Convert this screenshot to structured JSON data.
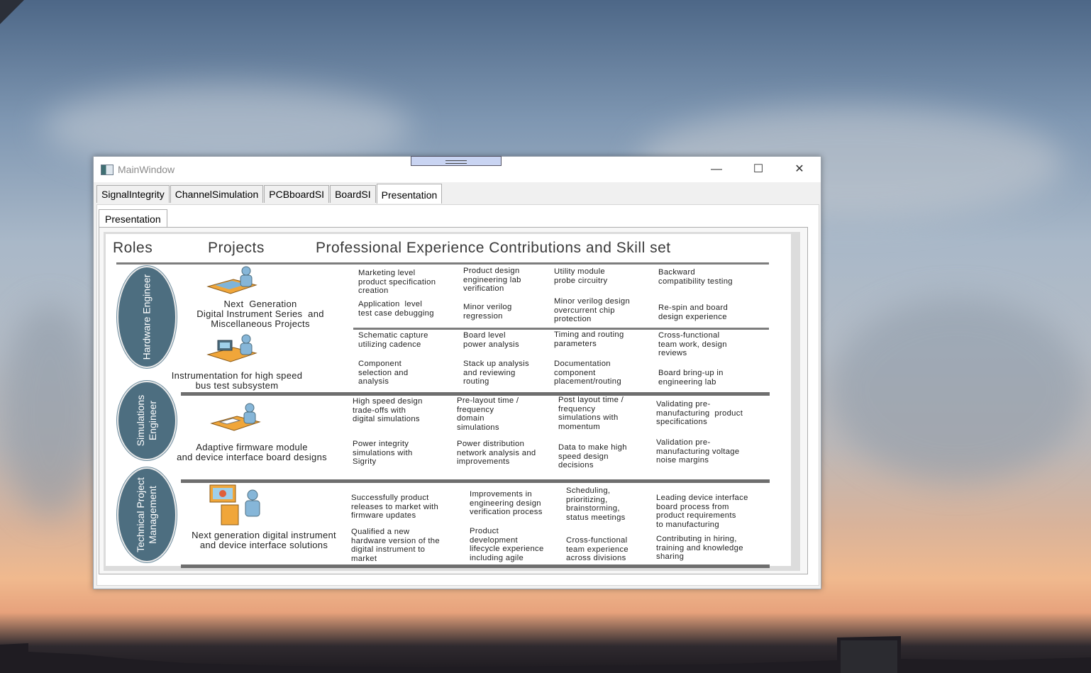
{
  "window": {
    "title": "MainWindow",
    "minimize_glyph": "—",
    "maximize_glyph": "☐",
    "close_glyph": "✕"
  },
  "tabs": [
    {
      "label": "SignalIntegrity",
      "active": false
    },
    {
      "label": "ChannelSimulation",
      "active": false
    },
    {
      "label": "PCBboardSI",
      "active": false
    },
    {
      "label": "BoardSI",
      "active": false
    },
    {
      "label": "Presentation",
      "active": true
    }
  ],
  "subtab": {
    "label": "Presentation"
  },
  "slide": {
    "headers": {
      "roles": "Roles",
      "projects": "Projects",
      "contributions": "Professional Experience Contributions and Skill set"
    },
    "roles": [
      {
        "label": "Hardware Engineer"
      },
      {
        "label": "Simulations\nEngineer"
      },
      {
        "label": "Technical Project\nManagement"
      }
    ],
    "projects": [
      {
        "label": "Next  Generation\nDigital Instrument Series  and\nMiscellaneous Projects"
      },
      {
        "label": "Instrumentation for high speed\nbus test subsystem"
      },
      {
        "label": "Adaptive firmware module\nand device interface board designs"
      },
      {
        "label": "Next generation digital instrument\nand device interface solutions"
      }
    ],
    "cells": [
      "Marketing level\nproduct specification\ncreation",
      "Product design\nengineering lab\nverification",
      "Utility module\nprobe circuitry",
      "Backward\ncompatibility testing",
      "Application  level\ntest case debugging",
      "Minor verilog\nregression",
      "Minor verilog design\novercurrent chip\nprotection",
      "Re-spin and board\ndesign experience",
      "Schematic capture\nutilizing cadence",
      "Board level\npower analysis",
      "Timing and routing\nparameters",
      "Cross-functional\nteam work, design\nreviews",
      "Component\nselection and\nanalysis",
      "Stack up analysis\nand reviewing\nrouting",
      "Documentation\ncomponent\nplacement/routing",
      "Board bring-up in\nengineering lab",
      "High speed design\ntrade-offs with\ndigital simulations",
      "Pre-layout time /\nfrequency\ndomain\nsimulations",
      "Post layout time /\nfrequency\nsimulations with\nmomentum",
      "Validating pre-\nmanufacturing  product\nspecifications",
      "Power integrity\nsimulations with\nSigrity",
      "Power distribution\nnetwork analysis and\nimprovements",
      "Data to make high\nspeed design\ndecisions",
      "Validation pre-\nmanufacturing voltage\nnoise margins",
      "Successfully product\nreleases to market with\nfirmware updates",
      "Improvements in\nengineering design\nverification process",
      "Scheduling,\nprioritizing,\nbrainstorming,\nstatus meetings",
      "Leading device interface\nboard process from\nproduct requirements\nto manufacturing",
      "Qualified a new\nhardware version of the\ndigital instrument to\nmarket",
      "Product\ndevelopment\nlifecycle experience\nincluding agile",
      "Cross-functional\nteam experience\nacross divisions",
      "Contributing in hiring,\ntraining and knowledge\nsharing"
    ]
  },
  "colors": {
    "role_fill": "#4d6e80",
    "titlebar": "#ffffff",
    "grip": "#c9d4f2"
  }
}
